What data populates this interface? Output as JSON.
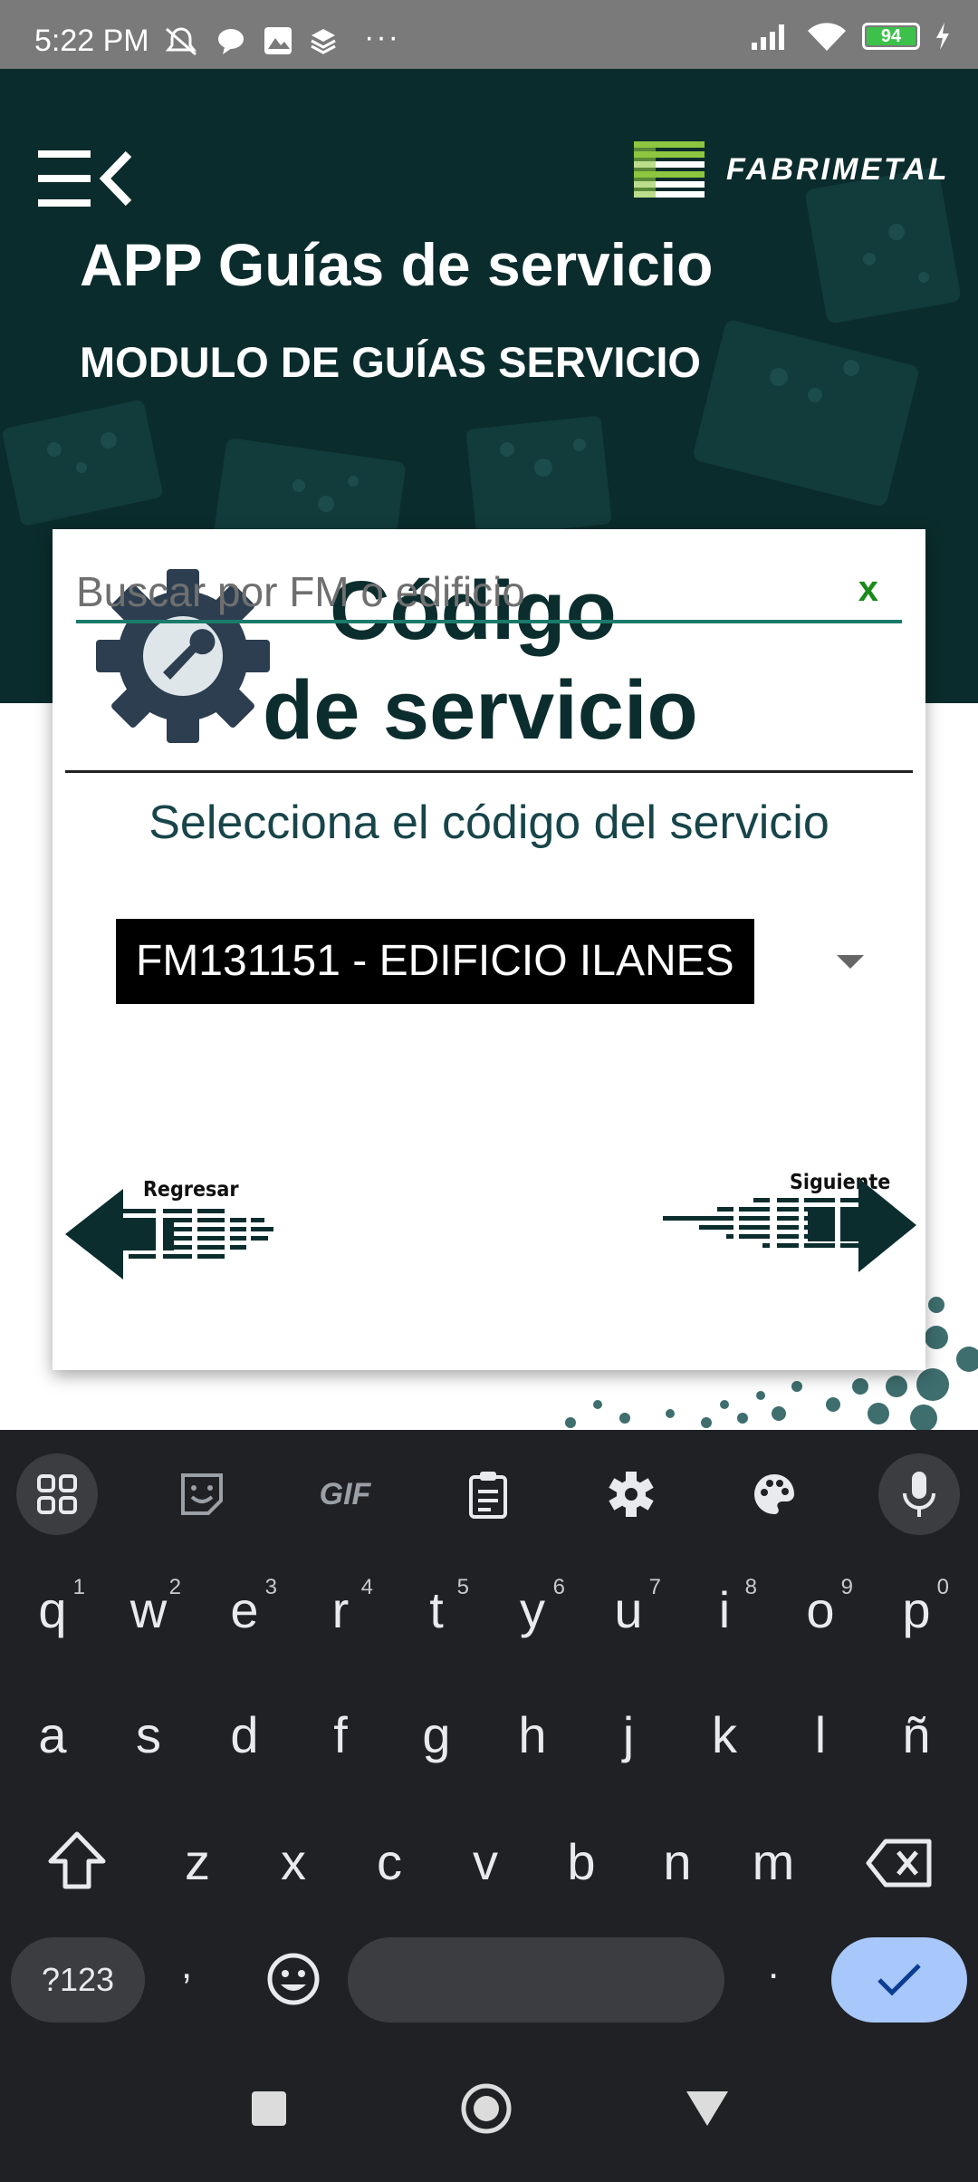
{
  "status_bar": {
    "time": "5:22 PM",
    "dots": "···",
    "battery_level": "94",
    "icons": [
      "mute-icon",
      "chat-icon",
      "photo-icon",
      "layers-icon",
      "signal-icon",
      "wifi-icon",
      "battery-icon",
      "charging-icon"
    ]
  },
  "header": {
    "app_title": "APP Guías de servicio",
    "module_title": "MODULO DE GUÍAS SERVICIO",
    "logo_text": "FABRIMETAL",
    "colors": {
      "background": "#0b2c2c",
      "logo_accent": "#8dc63f"
    }
  },
  "dialog": {
    "title_line1": "Código",
    "title_line2": "de servicio",
    "search_placeholder": "Buscar por FM o edificio",
    "search_clear": "x",
    "subtitle": "Selecciona el código del servicio",
    "selected_service": "FM131151 - EDIFICIO ILANES",
    "back_label": "Regresar",
    "next_label": "Siguiente"
  },
  "keyboard": {
    "toolbar": [
      "apps-icon",
      "sticker-icon",
      "gif-icon",
      "clipboard-icon",
      "settings-icon",
      "palette-icon",
      "mic-icon"
    ],
    "gif_label": "GIF",
    "row1": [
      "q",
      "w",
      "e",
      "r",
      "t",
      "y",
      "u",
      "i",
      "o",
      "p"
    ],
    "row1_hints": [
      "1",
      "2",
      "3",
      "4",
      "5",
      "6",
      "7",
      "8",
      "9",
      "0"
    ],
    "row2": [
      "a",
      "s",
      "d",
      "f",
      "g",
      "h",
      "j",
      "k",
      "l",
      "ñ"
    ],
    "row3": [
      "z",
      "x",
      "c",
      "v",
      "b",
      "n",
      "m"
    ],
    "symbols_label": "?123",
    "comma": ",",
    "period": "."
  }
}
